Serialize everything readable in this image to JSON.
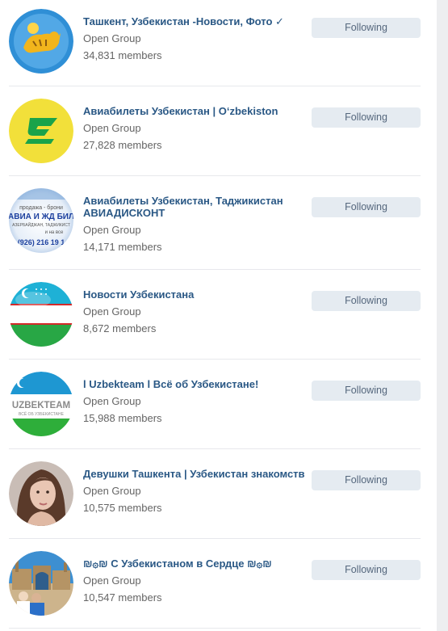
{
  "groups": [
    {
      "name": "Ташкент, Узбекистан -Новости, Фото ✓",
      "type": "Open Group",
      "members": "34,831 members",
      "button": "Following",
      "avatar": "tiger-emblem-icon"
    },
    {
      "name": "Авиабилеты Узбекистан | O‘zbekiston",
      "type": "Open Group",
      "members": "27,828 members",
      "button": "Following",
      "avatar": "airline-logo-icon"
    },
    {
      "name": "Авиабилеты Узбекистан, Таджикистан АВИАДИСКОНТ",
      "type": "Open Group",
      "members": "14,171 members",
      "button": "Following",
      "avatar": "ticket-ad-image",
      "avatar_text": [
        "продажа - брони",
        "АВИА И ЖД БИЛ",
        "АЗЕРБАЙДЖАН, ТАДЖИКИСТ",
        "и на все",
        "(926) 216 19 1"
      ]
    },
    {
      "name": "Новости Узбекистана",
      "type": "Open Group",
      "members": "8,672 members",
      "button": "Following",
      "avatar": "uzbek-flag-sphere-icon"
    },
    {
      "name": "l Uzbekteam l Всё об Узбекистане!",
      "type": "Open Group",
      "members": "15,988 members",
      "button": "Following",
      "avatar": "uzbekteam-logo-image",
      "avatar_text": [
        "UZBEKTEAM",
        "ВСЁ ОБ УЗБЕКИСТАНЕ"
      ]
    },
    {
      "name": "Девушки Ташкента | Узбекистан знакомств",
      "type": "Open Group",
      "members": "10,575 members",
      "button": "Following",
      "avatar": "woman-portrait-photo"
    },
    {
      "name": "₪۞₪ С Узбекистаном в Сердце ₪۞₪",
      "type": "Open Group",
      "members": "10,547 members",
      "button": "Following",
      "avatar": "registan-photo"
    }
  ],
  "colors": {
    "link": "#2a5885",
    "meta": "#656565",
    "button_bg": "#e5ebf1",
    "button_text": "#55677d",
    "divider": "#e7e8ec",
    "gutter": "#edeef0"
  }
}
